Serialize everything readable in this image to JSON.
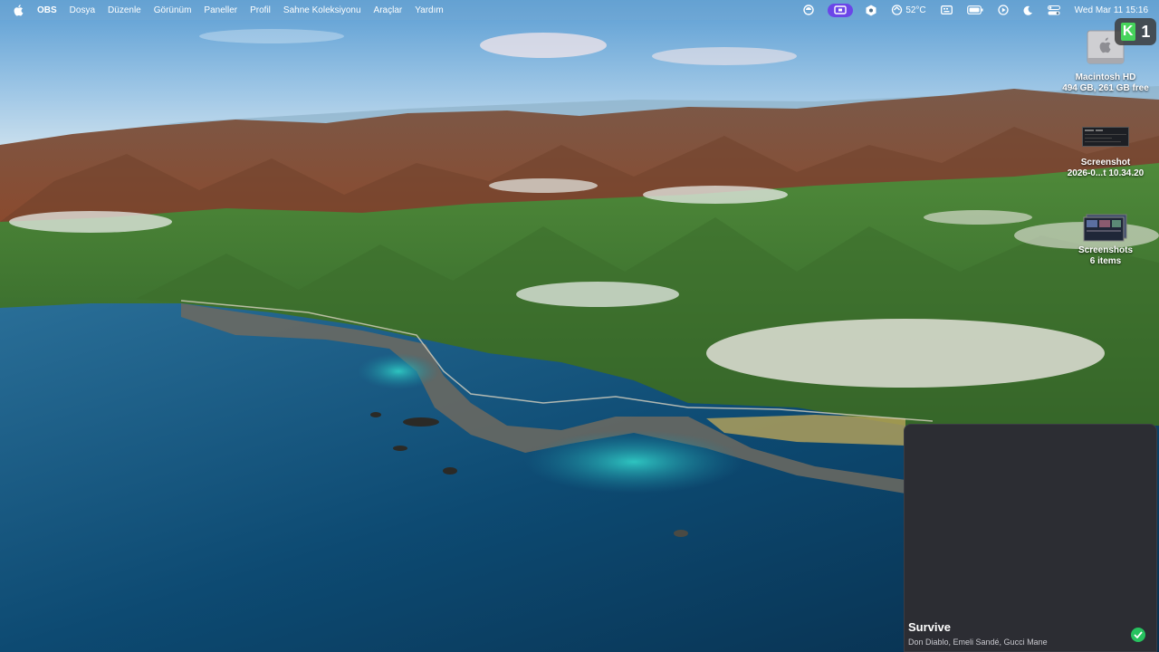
{
  "menubar": {
    "app_name": "OBS",
    "items": [
      "Dosya",
      "Düzenle",
      "Görünüm",
      "Paneller",
      "Profil",
      "Sahne Koleksiyonu",
      "Araçlar",
      "Yardım"
    ],
    "status": {
      "temperature": "52°C",
      "clock": "Wed Mar 11  15:16"
    },
    "colors": {
      "obs_pill": "#6b46e8"
    }
  },
  "desktop": {
    "hd": {
      "name": "Macintosh HD",
      "info": "494 GB, 261 GB free"
    },
    "screenshot": {
      "name": "Screenshot",
      "info": "2026-0...t 10.34.20"
    },
    "screenshots_folder": {
      "name": "Screenshots",
      "info": "6 items"
    },
    "badge": {
      "letter": "K",
      "count": "1"
    }
  },
  "now_playing": {
    "title": "Survive",
    "artist": "Don Diablo, Emeli Sandé, Gucci Mane",
    "status_icon": "checkmark-icon",
    "accent": "#27c25f"
  }
}
